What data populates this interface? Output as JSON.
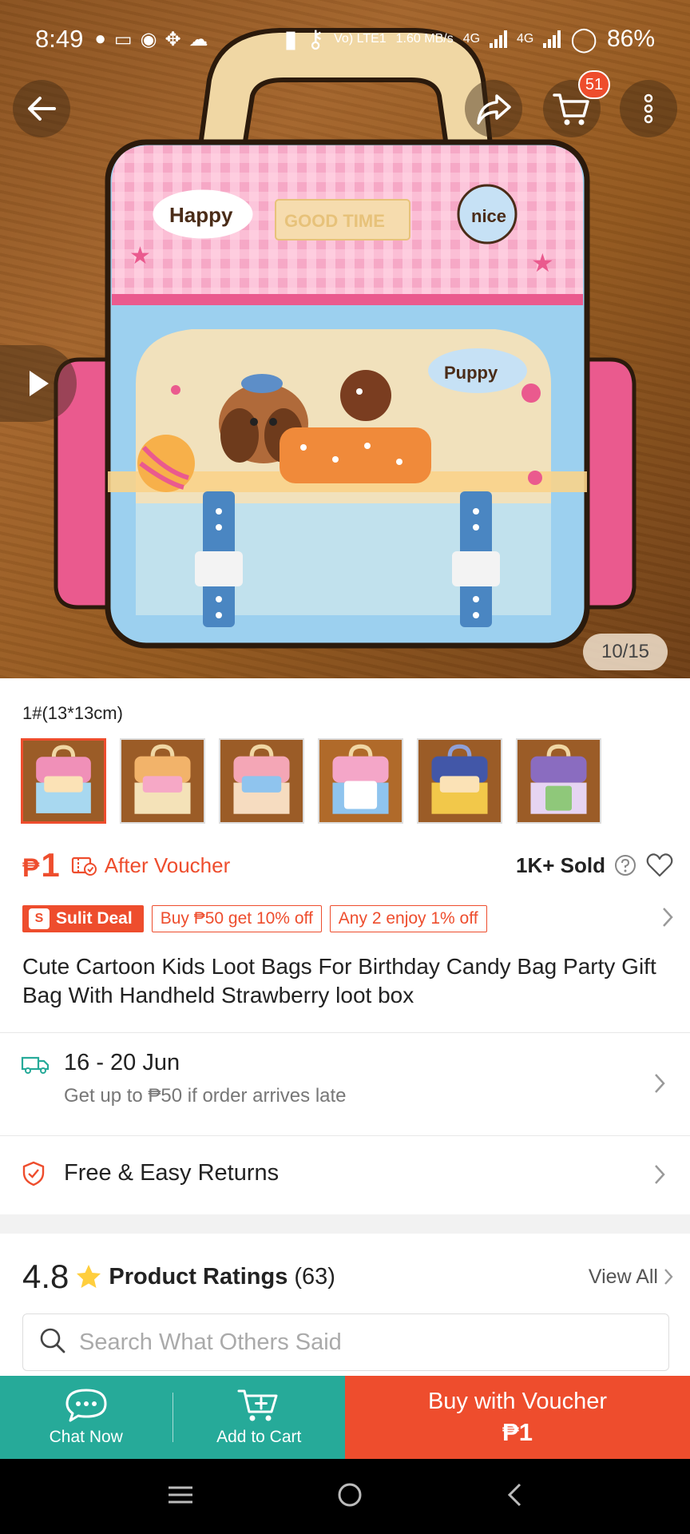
{
  "status_bar": {
    "time": "8:49",
    "network_lte": "Vo) LTE1",
    "speed": "1.60 MB/s",
    "net1": "4G",
    "net2": "4G",
    "battery": "86%"
  },
  "header": {
    "cart_count": "51",
    "image_counter": "10/15"
  },
  "variant": {
    "label": "1#(13*13cm)",
    "thumbnails": [
      {
        "scheme": "pink-blue",
        "top": "#f090b8",
        "bottom": "#a8d8f0"
      },
      {
        "scheme": "orange-cream",
        "top": "#f2b36a",
        "bottom": "#f4e2b8"
      },
      {
        "scheme": "pink-cream",
        "top": "#f4a6b6",
        "bottom": "#f6dcc0"
      },
      {
        "scheme": "blue-pink",
        "top": "#8fc4ee",
        "bottom": "#f4a6c8"
      },
      {
        "scheme": "navy-yellow",
        "top": "#4257a8",
        "bottom": "#f2c84a"
      },
      {
        "scheme": "purple-green",
        "top": "#8a6cc0",
        "bottom": "#8fc87a"
      }
    ]
  },
  "price": {
    "currency": "₱",
    "amount": "1",
    "after_voucher": "After Voucher",
    "sold": "1K+ Sold"
  },
  "promo": {
    "deal_logo": "S",
    "deal": "Sulit Deal",
    "tag1": "Buy ₱50 get 10% off",
    "tag2": "Any 2 enjoy 1% off"
  },
  "product": {
    "title": "Cute Cartoon Kids Loot Bags For Birthday Candy Bag Party Gift Bag With Handheld Strawberry loot box"
  },
  "image_text": {
    "happy": "Happy",
    "good_time": "GOOD TIME",
    "nice": "nice",
    "puppy": "Puppy"
  },
  "delivery": {
    "date": "16 - 20 Jun",
    "guarantee": "Get up to ₱50 if order arrives late"
  },
  "returns": {
    "label": "Free & Easy Returns"
  },
  "ratings": {
    "score": "4.8",
    "label": "Product Ratings",
    "count": "(63)",
    "view_all": "View All"
  },
  "search": {
    "placeholder": "Search What Others Said",
    "value": ""
  },
  "actions": {
    "chat": "Chat Now",
    "add_to_cart": "Add to Cart",
    "buy_line1": "Buy with Voucher",
    "buy_line2": "₱1"
  },
  "colors": {
    "brand": "#ee4d2d",
    "teal": "#26aa99"
  },
  "icons": [
    "back-arrow-icon",
    "share-icon",
    "cart-icon",
    "more-icon",
    "play-icon",
    "truck-icon",
    "shield-icon",
    "star-icon",
    "search-icon",
    "chat-icon",
    "add-cart-icon",
    "heart-icon",
    "help-icon",
    "chevron-right-icon"
  ]
}
